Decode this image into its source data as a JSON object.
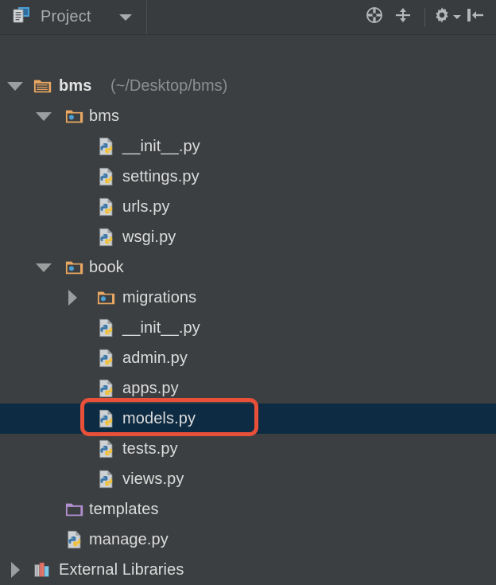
{
  "header": {
    "title": "Project",
    "title_icon": "project-window-icon",
    "dropdown_icon": "chevron-down-icon",
    "actions": [
      {
        "name": "scroll-from-source-button",
        "icon": "crosshair-target-icon"
      },
      {
        "name": "collapse-all-button",
        "icon": "collapse-all-icon"
      },
      {
        "name": "settings-button",
        "icon": "gear-icon"
      },
      {
        "name": "hide-panel-button",
        "icon": "hide-panel-icon"
      }
    ]
  },
  "colors": {
    "background": "#3c3f41",
    "header_background": "#393c3e",
    "selection": "#0d2b42",
    "text": "#dcdcdc",
    "muted_text": "#8b8f91",
    "annotation": "#e8503a",
    "folder": "#e8a762",
    "folder_excluded": "#b18fd0",
    "python_blue": "#3a76a8",
    "python_yellow": "#f0c03a"
  },
  "tree": {
    "rows": [
      {
        "id": "bms-root",
        "label": "bms",
        "secondary": "(~/Desktop/bms)",
        "icon": "folder-icon",
        "twisty": "expanded",
        "depth": 0,
        "bold": true,
        "selected": false
      },
      {
        "id": "bms-package",
        "label": "bms",
        "secondary": "",
        "icon": "source-folder-icon",
        "twisty": "expanded",
        "depth": 1,
        "bold": false,
        "selected": false
      },
      {
        "id": "bms-init",
        "label": "__init__.py",
        "secondary": "",
        "icon": "python-file-icon",
        "twisty": "none",
        "depth": 2,
        "bold": false,
        "selected": false
      },
      {
        "id": "bms-settings",
        "label": "settings.py",
        "secondary": "",
        "icon": "python-file-icon",
        "twisty": "none",
        "depth": 2,
        "bold": false,
        "selected": false
      },
      {
        "id": "bms-urls",
        "label": "urls.py",
        "secondary": "",
        "icon": "python-file-icon",
        "twisty": "none",
        "depth": 2,
        "bold": false,
        "selected": false
      },
      {
        "id": "bms-wsgi",
        "label": "wsgi.py",
        "secondary": "",
        "icon": "python-file-icon",
        "twisty": "none",
        "depth": 2,
        "bold": false,
        "selected": false
      },
      {
        "id": "book-package",
        "label": "book",
        "secondary": "",
        "icon": "source-folder-icon",
        "twisty": "expanded",
        "depth": 1,
        "bold": false,
        "selected": false
      },
      {
        "id": "book-migrations",
        "label": "migrations",
        "secondary": "",
        "icon": "source-folder-icon",
        "twisty": "collapsed",
        "depth": 2,
        "bold": false,
        "selected": false
      },
      {
        "id": "book-init",
        "label": "__init__.py",
        "secondary": "",
        "icon": "python-file-icon",
        "twisty": "none",
        "depth": 2,
        "bold": false,
        "selected": false
      },
      {
        "id": "book-admin",
        "label": "admin.py",
        "secondary": "",
        "icon": "python-file-icon",
        "twisty": "none",
        "depth": 2,
        "bold": false,
        "selected": false
      },
      {
        "id": "book-apps",
        "label": "apps.py",
        "secondary": "",
        "icon": "python-file-icon",
        "twisty": "none",
        "depth": 2,
        "bold": false,
        "selected": false
      },
      {
        "id": "book-models",
        "label": "models.py",
        "secondary": "",
        "icon": "python-file-icon",
        "twisty": "none",
        "depth": 2,
        "bold": false,
        "selected": true,
        "annotated": true
      },
      {
        "id": "book-tests",
        "label": "tests.py",
        "secondary": "",
        "icon": "python-file-icon",
        "twisty": "none",
        "depth": 2,
        "bold": false,
        "selected": false
      },
      {
        "id": "book-views",
        "label": "views.py",
        "secondary": "",
        "icon": "python-file-icon",
        "twisty": "none",
        "depth": 2,
        "bold": false,
        "selected": false
      },
      {
        "id": "templates",
        "label": "templates",
        "secondary": "",
        "icon": "excluded-folder-icon",
        "twisty": "none",
        "depth": 1,
        "bold": false,
        "selected": false
      },
      {
        "id": "manage-py",
        "label": "manage.py",
        "secondary": "",
        "icon": "python-file-icon",
        "twisty": "none",
        "depth": 1,
        "bold": false,
        "selected": false
      },
      {
        "id": "external-libraries",
        "label": "External Libraries",
        "secondary": "",
        "icon": "library-books-icon",
        "twisty": "collapsed",
        "depth": 0,
        "bold": false,
        "selected": false
      }
    ]
  },
  "annotation": {
    "target_row_id": "book-models",
    "shape": "rounded-rectangle",
    "color": "#e8503a"
  }
}
